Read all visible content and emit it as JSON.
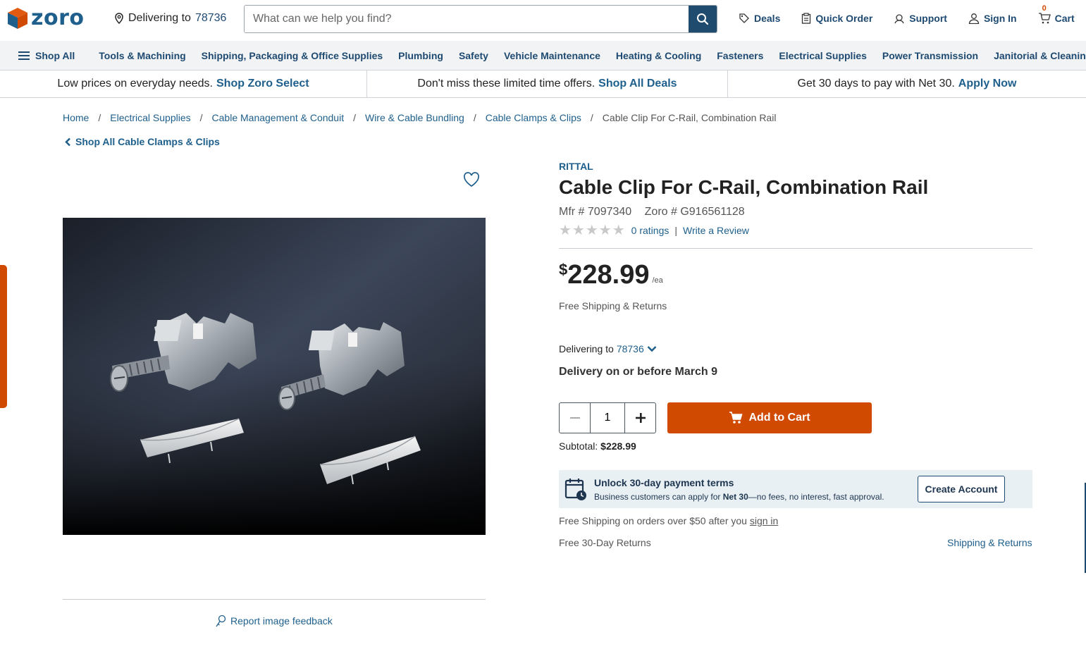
{
  "header": {
    "logo_text": "zoro",
    "delivering_label": "Delivering to",
    "delivering_zip": "78736",
    "search_placeholder": "What can we help you find?",
    "links": {
      "deals": "Deals",
      "quick_order": "Quick Order",
      "support": "Support",
      "sign_in": "Sign In",
      "cart": "Cart",
      "cart_count": "0"
    }
  },
  "nav": {
    "shop_all": "Shop All",
    "items": [
      "Tools & Machining",
      "Shipping, Packaging & Office Supplies",
      "Plumbing",
      "Safety",
      "Vehicle Maintenance",
      "Heating & Cooling",
      "Fasteners",
      "Electrical Supplies",
      "Power Transmission",
      "Janitorial & Cleaning Supplies"
    ]
  },
  "promo": [
    {
      "text": "Low prices on everyday needs.",
      "link": "Shop Zoro Select"
    },
    {
      "text": "Don't miss these limited time offers.",
      "link": "Shop All Deals"
    },
    {
      "text": "Get 30 days to pay with Net 30.",
      "link": "Apply Now"
    }
  ],
  "breadcrumb": {
    "items": [
      "Home",
      "Electrical Supplies",
      "Cable Management & Conduit",
      "Wire & Cable Bundling",
      "Cable Clamps & Clips"
    ],
    "current": "Cable Clip For C-Rail, Combination Rail"
  },
  "back_link": "Shop All Cable Clamps & Clips",
  "report_feedback": "Report image feedback",
  "product": {
    "brand": "RITTAL",
    "title": "Cable Clip For C-Rail, Combination Rail",
    "mfr": "Mfr # 7097340",
    "zoro": "Zoro # G916561128",
    "stars": "★★★★★",
    "ratings": "0 ratings",
    "rating_sep": "|",
    "write_review": "Write a Review",
    "price_currency": "$",
    "price_amount": "228.99",
    "price_unit": "/ea",
    "free_shipping": "Free Shipping & Returns",
    "delivering_label": "Delivering to",
    "delivering_zip": "78736",
    "delivery_date": "Delivery on or before March 9",
    "quantity": "1",
    "add_to_cart": "Add to Cart",
    "subtotal_label": "Subtotal:",
    "subtotal_value": "$228.99"
  },
  "net30": {
    "title": "Unlock 30-day payment terms",
    "desc_pre": "Business customers can apply for",
    "desc_bold": "Net 30",
    "desc_post": "—no fees, no interest, fast approval.",
    "button": "Create Account"
  },
  "shipping": {
    "over_text": "Free Shipping on orders over $50 after you",
    "sign_in": "sign in",
    "returns": "Free 30-Day Returns",
    "shipping_returns": "Shipping & Returns"
  },
  "colors": {
    "brand_blue": "#1e5f8c",
    "dark_blue": "#1f4b6e",
    "accent_orange": "#d04a02"
  }
}
